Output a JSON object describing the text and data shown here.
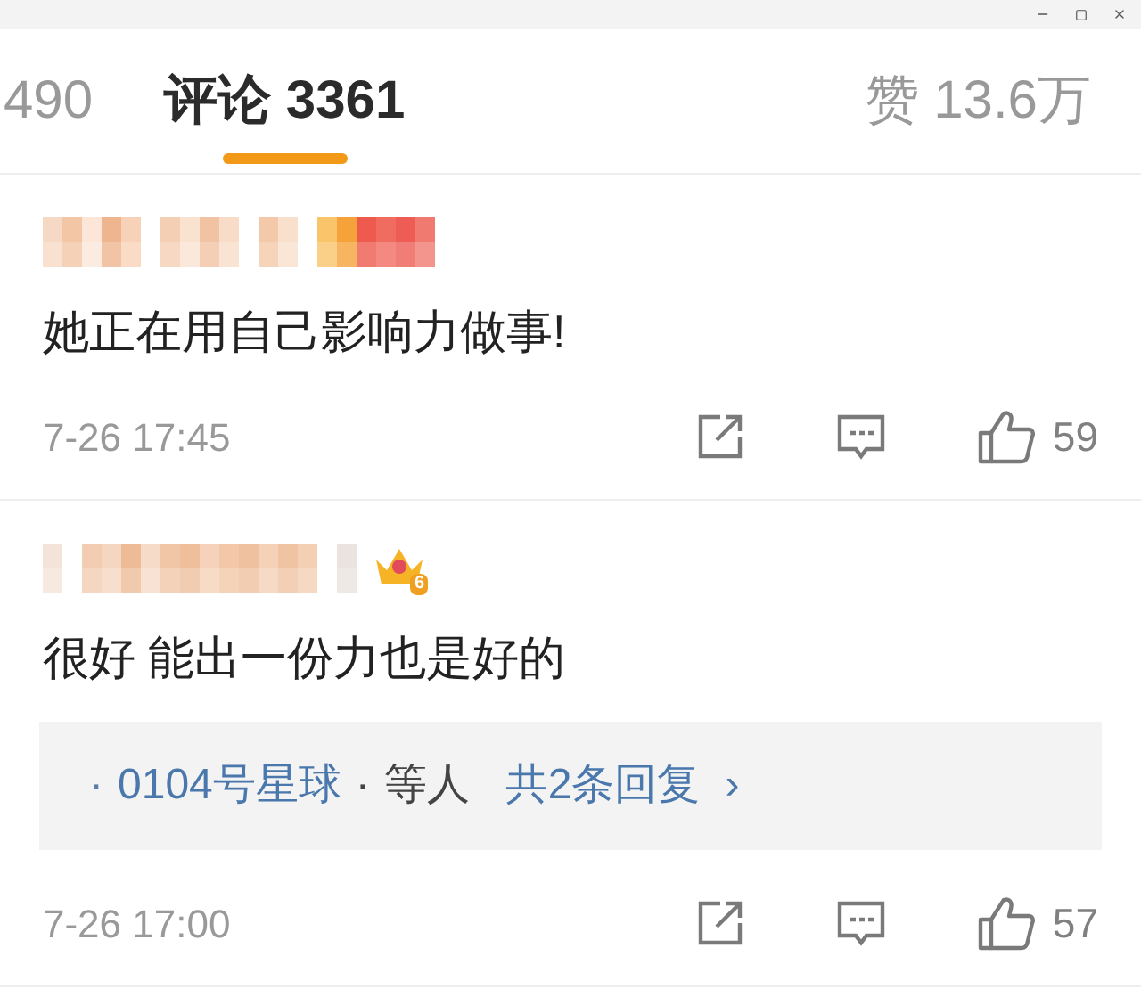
{
  "tabs": [
    {
      "label": "490",
      "selected": false
    },
    {
      "label": "评论 3361",
      "selected": true
    }
  ],
  "likes_total": "赞 13.6万",
  "comments": [
    {
      "kind": "plain",
      "text": "她正在用自己影响力做事!",
      "time": "7-26 17:45",
      "likes": "59"
    },
    {
      "kind": "crown",
      "badge_level": "6",
      "text": "很好 能出一份力也是好的",
      "replies": {
        "lead": "·",
        "user": "0104号星球",
        "sep": "·",
        "others": "等人",
        "count_link": "共2条回复",
        "chevron": "›"
      },
      "time": "7-26 17:00",
      "likes": "57"
    }
  ]
}
